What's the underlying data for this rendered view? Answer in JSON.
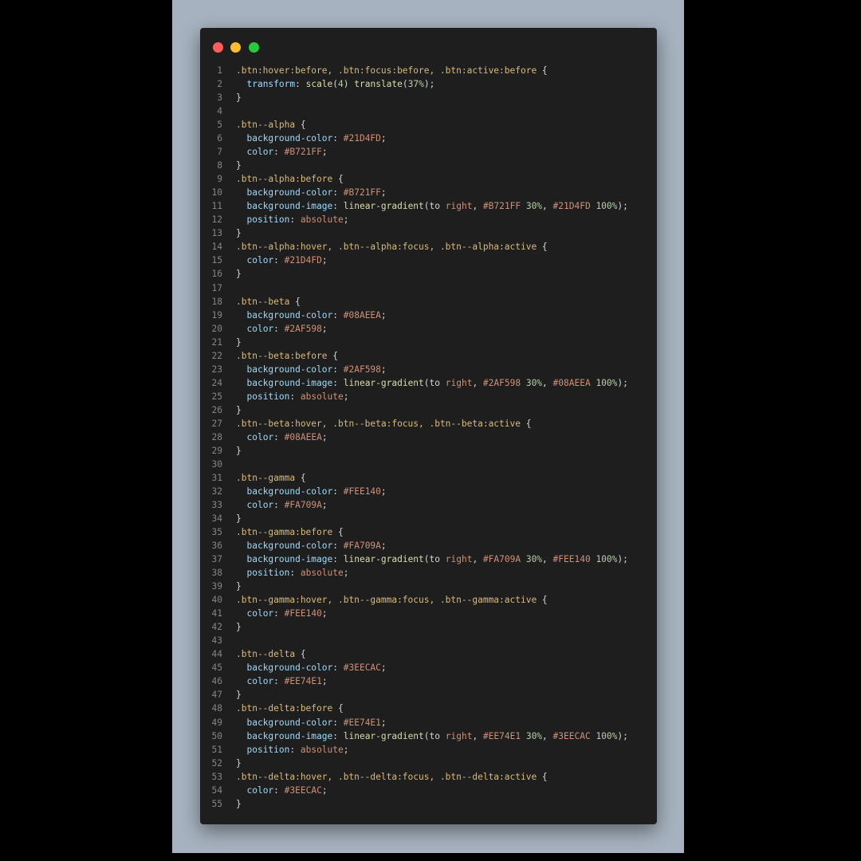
{
  "colors": {
    "backdrop": "#a6b2bf",
    "window_bg": "#1e1e1e",
    "dot_red": "#ff5f56",
    "dot_yellow": "#ffbd2e",
    "dot_green": "#27c93f"
  },
  "window_controls": [
    "close-dot",
    "minimize-dot",
    "maximize-dot"
  ],
  "code_lines": [
    {
      "n": "1",
      "tokens": [
        {
          "t": ".btn:hover:before, .btn:focus:before, .btn:active:before",
          "c": "sel"
        },
        {
          "t": " {",
          "c": "pun"
        }
      ]
    },
    {
      "n": "2",
      "tokens": [
        {
          "t": "  ",
          "c": "pun"
        },
        {
          "t": "transform",
          "c": "prop"
        },
        {
          "t": ": ",
          "c": "pun"
        },
        {
          "t": "scale",
          "c": "fn"
        },
        {
          "t": "(",
          "c": "pun"
        },
        {
          "t": "4",
          "c": "num"
        },
        {
          "t": ") ",
          "c": "pun"
        },
        {
          "t": "translate",
          "c": "fn"
        },
        {
          "t": "(",
          "c": "pun"
        },
        {
          "t": "37%",
          "c": "num"
        },
        {
          "t": ");",
          "c": "pun"
        }
      ]
    },
    {
      "n": "3",
      "tokens": [
        {
          "t": "}",
          "c": "pun"
        }
      ]
    },
    {
      "n": "4",
      "tokens": []
    },
    {
      "n": "5",
      "tokens": [
        {
          "t": ".btn--alpha",
          "c": "sel"
        },
        {
          "t": " {",
          "c": "pun"
        }
      ]
    },
    {
      "n": "6",
      "tokens": [
        {
          "t": "  ",
          "c": "pun"
        },
        {
          "t": "background-color",
          "c": "prop"
        },
        {
          "t": ": ",
          "c": "pun"
        },
        {
          "t": "#21D4FD",
          "c": "val"
        },
        {
          "t": ";",
          "c": "pun"
        }
      ]
    },
    {
      "n": "7",
      "tokens": [
        {
          "t": "  ",
          "c": "pun"
        },
        {
          "t": "color",
          "c": "prop"
        },
        {
          "t": ": ",
          "c": "pun"
        },
        {
          "t": "#B721FF",
          "c": "val"
        },
        {
          "t": ";",
          "c": "pun"
        }
      ]
    },
    {
      "n": "8",
      "tokens": [
        {
          "t": "}",
          "c": "pun"
        }
      ]
    },
    {
      "n": "9",
      "tokens": [
        {
          "t": ".btn--alpha:before",
          "c": "sel"
        },
        {
          "t": " {",
          "c": "pun"
        }
      ]
    },
    {
      "n": "10",
      "tokens": [
        {
          "t": "  ",
          "c": "pun"
        },
        {
          "t": "background-color",
          "c": "prop"
        },
        {
          "t": ": ",
          "c": "pun"
        },
        {
          "t": "#B721FF",
          "c": "val"
        },
        {
          "t": ";",
          "c": "pun"
        }
      ]
    },
    {
      "n": "11",
      "tokens": [
        {
          "t": "  ",
          "c": "pun"
        },
        {
          "t": "background-image",
          "c": "prop"
        },
        {
          "t": ": ",
          "c": "pun"
        },
        {
          "t": "linear-gradient",
          "c": "fn"
        },
        {
          "t": "(to ",
          "c": "pun"
        },
        {
          "t": "right",
          "c": "val"
        },
        {
          "t": ", ",
          "c": "pun"
        },
        {
          "t": "#B721FF",
          "c": "val"
        },
        {
          "t": " ",
          "c": "pun"
        },
        {
          "t": "30%",
          "c": "num"
        },
        {
          "t": ", ",
          "c": "pun"
        },
        {
          "t": "#21D4FD",
          "c": "val"
        },
        {
          "t": " ",
          "c": "pun"
        },
        {
          "t": "100%",
          "c": "num"
        },
        {
          "t": ");",
          "c": "pun"
        }
      ]
    },
    {
      "n": "12",
      "tokens": [
        {
          "t": "  ",
          "c": "pun"
        },
        {
          "t": "position",
          "c": "prop"
        },
        {
          "t": ": ",
          "c": "pun"
        },
        {
          "t": "absolute",
          "c": "val"
        },
        {
          "t": ";",
          "c": "pun"
        }
      ]
    },
    {
      "n": "13",
      "tokens": [
        {
          "t": "}",
          "c": "pun"
        }
      ]
    },
    {
      "n": "14",
      "tokens": [
        {
          "t": ".btn--alpha:hover, .btn--alpha:focus, .btn--alpha:active",
          "c": "sel"
        },
        {
          "t": " {",
          "c": "pun"
        }
      ]
    },
    {
      "n": "15",
      "tokens": [
        {
          "t": "  ",
          "c": "pun"
        },
        {
          "t": "color",
          "c": "prop"
        },
        {
          "t": ": ",
          "c": "pun"
        },
        {
          "t": "#21D4FD",
          "c": "val"
        },
        {
          "t": ";",
          "c": "pun"
        }
      ]
    },
    {
      "n": "16",
      "tokens": [
        {
          "t": "}",
          "c": "pun"
        }
      ]
    },
    {
      "n": "17",
      "tokens": []
    },
    {
      "n": "18",
      "tokens": [
        {
          "t": ".btn--beta",
          "c": "sel"
        },
        {
          "t": " {",
          "c": "pun"
        }
      ]
    },
    {
      "n": "19",
      "tokens": [
        {
          "t": "  ",
          "c": "pun"
        },
        {
          "t": "background-color",
          "c": "prop"
        },
        {
          "t": ": ",
          "c": "pun"
        },
        {
          "t": "#08AEEA",
          "c": "val"
        },
        {
          "t": ";",
          "c": "pun"
        }
      ]
    },
    {
      "n": "20",
      "tokens": [
        {
          "t": "  ",
          "c": "pun"
        },
        {
          "t": "color",
          "c": "prop"
        },
        {
          "t": ": ",
          "c": "pun"
        },
        {
          "t": "#2AF598",
          "c": "val"
        },
        {
          "t": ";",
          "c": "pun"
        }
      ]
    },
    {
      "n": "21",
      "tokens": [
        {
          "t": "}",
          "c": "pun"
        }
      ]
    },
    {
      "n": "22",
      "tokens": [
        {
          "t": ".btn--beta:before",
          "c": "sel"
        },
        {
          "t": " {",
          "c": "pun"
        }
      ]
    },
    {
      "n": "23",
      "tokens": [
        {
          "t": "  ",
          "c": "pun"
        },
        {
          "t": "background-color",
          "c": "prop"
        },
        {
          "t": ": ",
          "c": "pun"
        },
        {
          "t": "#2AF598",
          "c": "val"
        },
        {
          "t": ";",
          "c": "pun"
        }
      ]
    },
    {
      "n": "24",
      "tokens": [
        {
          "t": "  ",
          "c": "pun"
        },
        {
          "t": "background-image",
          "c": "prop"
        },
        {
          "t": ": ",
          "c": "pun"
        },
        {
          "t": "linear-gradient",
          "c": "fn"
        },
        {
          "t": "(to ",
          "c": "pun"
        },
        {
          "t": "right",
          "c": "val"
        },
        {
          "t": ", ",
          "c": "pun"
        },
        {
          "t": "#2AF598",
          "c": "val"
        },
        {
          "t": " ",
          "c": "pun"
        },
        {
          "t": "30%",
          "c": "num"
        },
        {
          "t": ", ",
          "c": "pun"
        },
        {
          "t": "#08AEEA",
          "c": "val"
        },
        {
          "t": " ",
          "c": "pun"
        },
        {
          "t": "100%",
          "c": "num"
        },
        {
          "t": ");",
          "c": "pun"
        }
      ]
    },
    {
      "n": "25",
      "tokens": [
        {
          "t": "  ",
          "c": "pun"
        },
        {
          "t": "position",
          "c": "prop"
        },
        {
          "t": ": ",
          "c": "pun"
        },
        {
          "t": "absolute",
          "c": "val"
        },
        {
          "t": ";",
          "c": "pun"
        }
      ]
    },
    {
      "n": "26",
      "tokens": [
        {
          "t": "}",
          "c": "pun"
        }
      ]
    },
    {
      "n": "27",
      "tokens": [
        {
          "t": ".btn--beta:hover, .btn--beta:focus, .btn--beta:active",
          "c": "sel"
        },
        {
          "t": " {",
          "c": "pun"
        }
      ]
    },
    {
      "n": "28",
      "tokens": [
        {
          "t": "  ",
          "c": "pun"
        },
        {
          "t": "color",
          "c": "prop"
        },
        {
          "t": ": ",
          "c": "pun"
        },
        {
          "t": "#08AEEA",
          "c": "val"
        },
        {
          "t": ";",
          "c": "pun"
        }
      ]
    },
    {
      "n": "29",
      "tokens": [
        {
          "t": "}",
          "c": "pun"
        }
      ]
    },
    {
      "n": "30",
      "tokens": []
    },
    {
      "n": "31",
      "tokens": [
        {
          "t": ".btn--gamma",
          "c": "sel"
        },
        {
          "t": " {",
          "c": "pun"
        }
      ]
    },
    {
      "n": "32",
      "tokens": [
        {
          "t": "  ",
          "c": "pun"
        },
        {
          "t": "background-color",
          "c": "prop"
        },
        {
          "t": ": ",
          "c": "pun"
        },
        {
          "t": "#FEE140",
          "c": "val"
        },
        {
          "t": ";",
          "c": "pun"
        }
      ]
    },
    {
      "n": "33",
      "tokens": [
        {
          "t": "  ",
          "c": "pun"
        },
        {
          "t": "color",
          "c": "prop"
        },
        {
          "t": ": ",
          "c": "pun"
        },
        {
          "t": "#FA709A",
          "c": "val"
        },
        {
          "t": ";",
          "c": "pun"
        }
      ]
    },
    {
      "n": "34",
      "tokens": [
        {
          "t": "}",
          "c": "pun"
        }
      ]
    },
    {
      "n": "35",
      "tokens": [
        {
          "t": ".btn--gamma:before",
          "c": "sel"
        },
        {
          "t": " {",
          "c": "pun"
        }
      ]
    },
    {
      "n": "36",
      "tokens": [
        {
          "t": "  ",
          "c": "pun"
        },
        {
          "t": "background-color",
          "c": "prop"
        },
        {
          "t": ": ",
          "c": "pun"
        },
        {
          "t": "#FA709A",
          "c": "val"
        },
        {
          "t": ";",
          "c": "pun"
        }
      ]
    },
    {
      "n": "37",
      "tokens": [
        {
          "t": "  ",
          "c": "pun"
        },
        {
          "t": "background-image",
          "c": "prop"
        },
        {
          "t": ": ",
          "c": "pun"
        },
        {
          "t": "linear-gradient",
          "c": "fn"
        },
        {
          "t": "(to ",
          "c": "pun"
        },
        {
          "t": "right",
          "c": "val"
        },
        {
          "t": ", ",
          "c": "pun"
        },
        {
          "t": "#FA709A",
          "c": "val"
        },
        {
          "t": " ",
          "c": "pun"
        },
        {
          "t": "30%",
          "c": "num"
        },
        {
          "t": ", ",
          "c": "pun"
        },
        {
          "t": "#FEE140",
          "c": "val"
        },
        {
          "t": " ",
          "c": "pun"
        },
        {
          "t": "100%",
          "c": "num"
        },
        {
          "t": ");",
          "c": "pun"
        }
      ]
    },
    {
      "n": "38",
      "tokens": [
        {
          "t": "  ",
          "c": "pun"
        },
        {
          "t": "position",
          "c": "prop"
        },
        {
          "t": ": ",
          "c": "pun"
        },
        {
          "t": "absolute",
          "c": "val"
        },
        {
          "t": ";",
          "c": "pun"
        }
      ]
    },
    {
      "n": "39",
      "tokens": [
        {
          "t": "}",
          "c": "pun"
        }
      ]
    },
    {
      "n": "40",
      "tokens": [
        {
          "t": ".btn--gamma:hover, .btn--gamma:focus, .btn--gamma:active",
          "c": "sel"
        },
        {
          "t": " {",
          "c": "pun"
        }
      ]
    },
    {
      "n": "41",
      "tokens": [
        {
          "t": "  ",
          "c": "pun"
        },
        {
          "t": "color",
          "c": "prop"
        },
        {
          "t": ": ",
          "c": "pun"
        },
        {
          "t": "#FEE140",
          "c": "val"
        },
        {
          "t": ";",
          "c": "pun"
        }
      ]
    },
    {
      "n": "42",
      "tokens": [
        {
          "t": "}",
          "c": "pun"
        }
      ]
    },
    {
      "n": "43",
      "tokens": []
    },
    {
      "n": "44",
      "tokens": [
        {
          "t": ".btn--delta",
          "c": "sel"
        },
        {
          "t": " {",
          "c": "pun"
        }
      ]
    },
    {
      "n": "45",
      "tokens": [
        {
          "t": "  ",
          "c": "pun"
        },
        {
          "t": "background-color",
          "c": "prop"
        },
        {
          "t": ": ",
          "c": "pun"
        },
        {
          "t": "#3EECAC",
          "c": "val"
        },
        {
          "t": ";",
          "c": "pun"
        }
      ]
    },
    {
      "n": "46",
      "tokens": [
        {
          "t": "  ",
          "c": "pun"
        },
        {
          "t": "color",
          "c": "prop"
        },
        {
          "t": ": ",
          "c": "pun"
        },
        {
          "t": "#EE74E1",
          "c": "val"
        },
        {
          "t": ";",
          "c": "pun"
        }
      ]
    },
    {
      "n": "47",
      "tokens": [
        {
          "t": "}",
          "c": "pun"
        }
      ]
    },
    {
      "n": "48",
      "tokens": [
        {
          "t": ".btn--delta:before",
          "c": "sel"
        },
        {
          "t": " {",
          "c": "pun"
        }
      ]
    },
    {
      "n": "49",
      "tokens": [
        {
          "t": "  ",
          "c": "pun"
        },
        {
          "t": "background-color",
          "c": "prop"
        },
        {
          "t": ": ",
          "c": "pun"
        },
        {
          "t": "#EE74E1",
          "c": "val"
        },
        {
          "t": ";",
          "c": "pun"
        }
      ]
    },
    {
      "n": "50",
      "tokens": [
        {
          "t": "  ",
          "c": "pun"
        },
        {
          "t": "background-image",
          "c": "prop"
        },
        {
          "t": ": ",
          "c": "pun"
        },
        {
          "t": "linear-gradient",
          "c": "fn"
        },
        {
          "t": "(to ",
          "c": "pun"
        },
        {
          "t": "right",
          "c": "val"
        },
        {
          "t": ", ",
          "c": "pun"
        },
        {
          "t": "#EE74E1",
          "c": "val"
        },
        {
          "t": " ",
          "c": "pun"
        },
        {
          "t": "30%",
          "c": "num"
        },
        {
          "t": ", ",
          "c": "pun"
        },
        {
          "t": "#3EECAC",
          "c": "val"
        },
        {
          "t": " ",
          "c": "pun"
        },
        {
          "t": "100%",
          "c": "num"
        },
        {
          "t": ");",
          "c": "pun"
        }
      ]
    },
    {
      "n": "51",
      "tokens": [
        {
          "t": "  ",
          "c": "pun"
        },
        {
          "t": "position",
          "c": "prop"
        },
        {
          "t": ": ",
          "c": "pun"
        },
        {
          "t": "absolute",
          "c": "val"
        },
        {
          "t": ";",
          "c": "pun"
        }
      ]
    },
    {
      "n": "52",
      "tokens": [
        {
          "t": "}",
          "c": "pun"
        }
      ]
    },
    {
      "n": "53",
      "tokens": [
        {
          "t": ".btn--delta:hover, .btn--delta:focus, .btn--delta:active",
          "c": "sel"
        },
        {
          "t": " {",
          "c": "pun"
        }
      ]
    },
    {
      "n": "54",
      "tokens": [
        {
          "t": "  ",
          "c": "pun"
        },
        {
          "t": "color",
          "c": "prop"
        },
        {
          "t": ": ",
          "c": "pun"
        },
        {
          "t": "#3EECAC",
          "c": "val"
        },
        {
          "t": ";",
          "c": "pun"
        }
      ]
    },
    {
      "n": "55",
      "tokens": [
        {
          "t": "}",
          "c": "pun"
        }
      ]
    }
  ]
}
